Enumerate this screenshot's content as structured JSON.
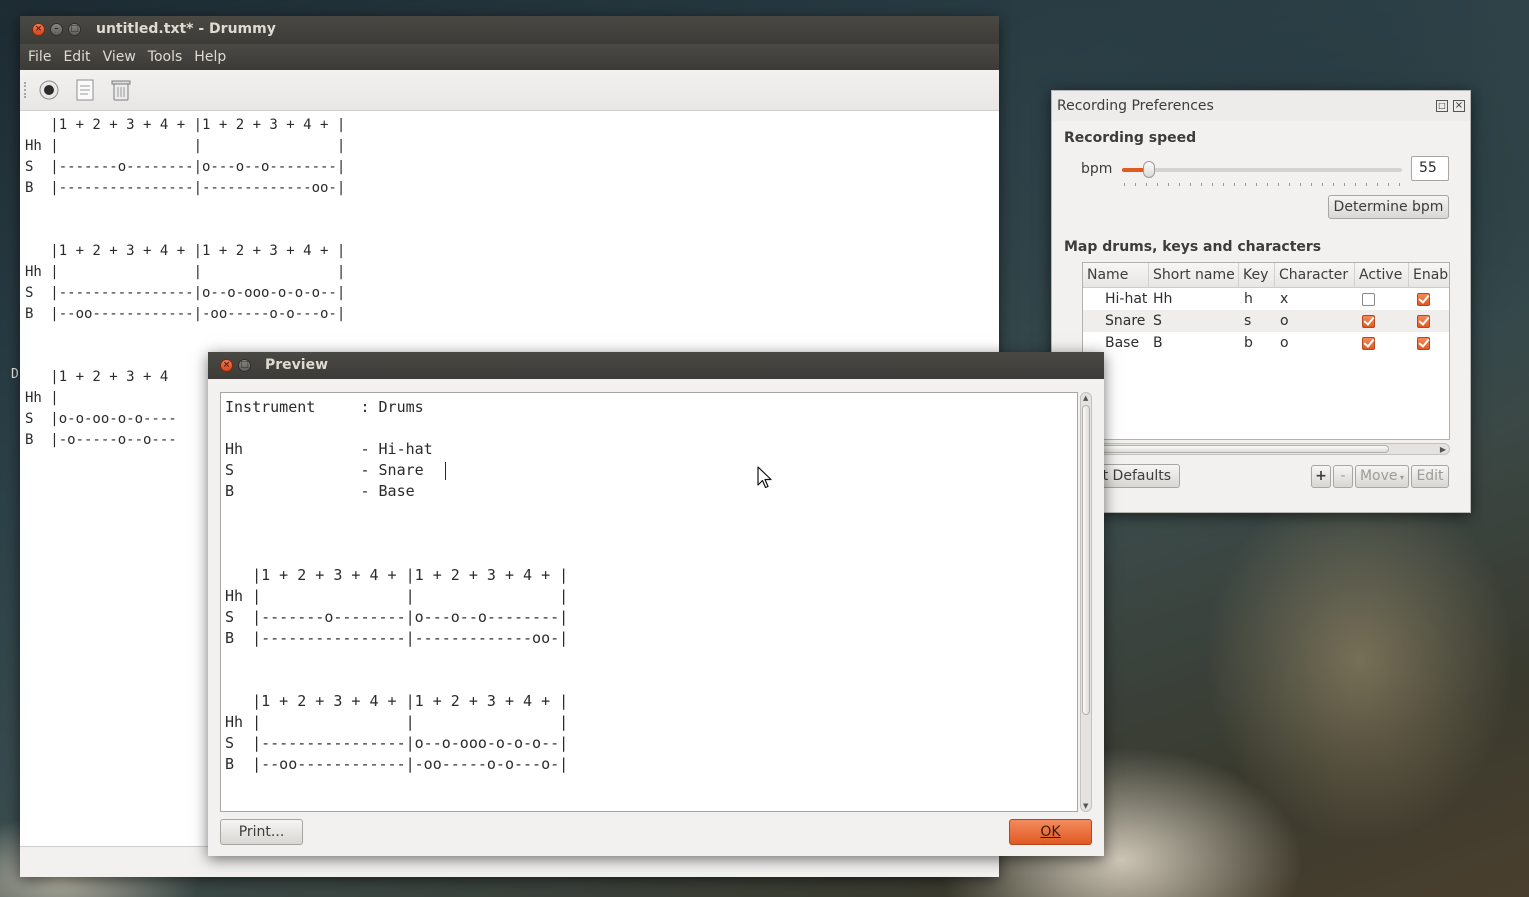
{
  "main_window": {
    "title": "untitled.txt* - Drummy",
    "menu": [
      "File",
      "Edit",
      "View",
      "Tools",
      "Help"
    ],
    "toolbar": {
      "record_icon": "record-icon",
      "document_icon": "document-icon",
      "trash_icon": "trash-icon"
    },
    "editor_text": "   |1 + 2 + 3 + 4 + |1 + 2 + 3 + 4 + |\nHh |                |                |\nS  |-------o--------|o---o--o--------|\nB  |----------------|-------------oo-|\n\n\n   |1 + 2 + 3 + 4 + |1 + 2 + 3 + 4 + |\nHh |                |                |\nS  |----------------|o--o-ooo-o-o-o--|\nB  |--oo------------|-oo-----o-o---o-|\n\n\n   |1 + 2 + 3 + 4 \nHh |\nS  |o-o-oo-o-o----\nB  |-o-----o--o---"
  },
  "preferences": {
    "title": "Recording Preferences",
    "speed_heading": "Recording speed",
    "bpm_label": "bpm",
    "bpm_value": "55",
    "bpm_fraction": 0.04,
    "determine_label": "Determine bpm",
    "map_heading": "Map drums, keys and characters",
    "columns": [
      "Name",
      "Short name",
      "Key",
      "Character",
      "Active",
      "Enabl"
    ],
    "rows": [
      {
        "name": "Hi-hat",
        "short": "Hh",
        "key": "h",
        "char": "x",
        "active": false,
        "enabled": true
      },
      {
        "name": "Snare",
        "short": "S",
        "key": "s",
        "char": "o",
        "active": true,
        "enabled": true
      },
      {
        "name": "Base",
        "short": "B",
        "key": "b",
        "char": "o",
        "active": true,
        "enabled": true
      }
    ],
    "defaults_label": "t Defaults",
    "add_label": "+",
    "remove_label": "-",
    "move_label": "Move",
    "edit_label": "Edit"
  },
  "preview": {
    "title": "Preview",
    "text": "Instrument     : Drums\n\nHh             - Hi-hat\nS              - Snare\nB              - Base\n\n\n\n   |1 + 2 + 3 + 4 + |1 + 2 + 3 + 4 + |\nHh |                |                |\nS  |-------o--------|o---o--o--------|\nB  |----------------|-------------oo-|\n\n\n   |1 + 2 + 3 + 4 + |1 + 2 + 3 + 4 + |\nHh |                |                |\nS  |----------------|o--o-ooo-o-o-o--|\nB  |--oo------------|-oo-----o-o---o-|",
    "print_label": "Print...",
    "ok_label": "OK"
  },
  "desktop_edge_char": "D"
}
